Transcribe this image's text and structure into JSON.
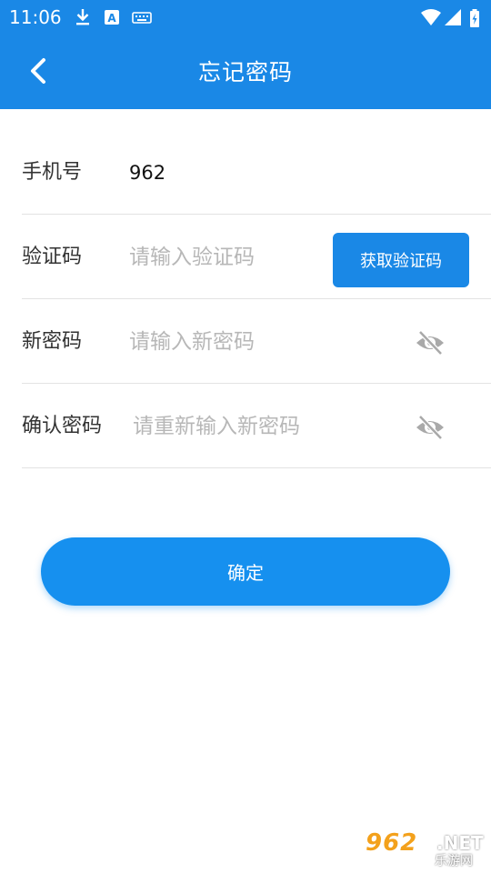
{
  "status_bar": {
    "time": "11:06",
    "icons": [
      "download-icon",
      "keyboard-a-icon",
      "keyboard-icon",
      "wifi-icon",
      "signal-icon",
      "battery-charging-icon"
    ]
  },
  "header": {
    "title": "忘记密码",
    "back_icon": "back-chevron-icon"
  },
  "form": {
    "phone": {
      "label": "手机号",
      "value": "962"
    },
    "code": {
      "label": "验证码",
      "placeholder": "请输入验证码",
      "button": "获取验证码"
    },
    "new_password": {
      "label": "新密码",
      "placeholder": "请输入新密码",
      "icon": "eye-off-icon"
    },
    "confirm_password": {
      "label": "确认密码",
      "placeholder": "请重新输入新密码",
      "icon": "eye-off-icon"
    }
  },
  "confirm_button": {
    "label": "确定"
  },
  "watermark": {
    "brand": "962",
    "domain": ".NET",
    "sub": "乐游网"
  },
  "colors": {
    "primary": "#1a88e6",
    "button": "#1690ef",
    "placeholder": "#b7b7b7",
    "divider": "#e3e3e3"
  }
}
